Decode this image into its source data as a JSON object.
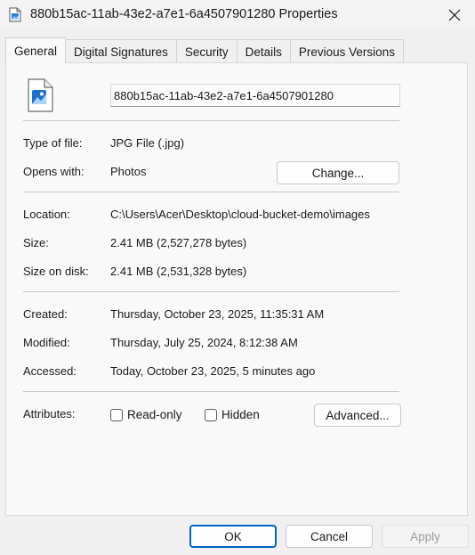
{
  "window": {
    "title": "880b15ac-11ab-43e2-a7e1-6a4507901280 Properties",
    "close_icon": "close-icon",
    "app_icon": "image-file-icon"
  },
  "tabs": [
    {
      "label": "General",
      "active": true
    },
    {
      "label": "Digital Signatures",
      "active": false
    },
    {
      "label": "Security",
      "active": false
    },
    {
      "label": "Details",
      "active": false
    },
    {
      "label": "Previous Versions",
      "active": false
    }
  ],
  "general": {
    "file_icon": "image-file-icon",
    "filename": "880b15ac-11ab-43e2-a7e1-6a4507901280",
    "type_label": "Type of file:",
    "type_value": "JPG File (.jpg)",
    "opens_label": "Opens with:",
    "opens_value": "Photos",
    "change_button": "Change...",
    "location_label": "Location:",
    "location_value": "C:\\Users\\Acer\\Desktop\\cloud-bucket-demo\\images",
    "size_label": "Size:",
    "size_value": "2.41 MB (2,527,278 bytes)",
    "size_disk_label": "Size on disk:",
    "size_disk_value": "2.41 MB (2,531,328 bytes)",
    "created_label": "Created:",
    "created_value": "Thursday, October 23, 2025, 11:35:31 AM",
    "modified_label": "Modified:",
    "modified_value": "Thursday, July 25, 2024, 8:12:38 AM",
    "accessed_label": "Accessed:",
    "accessed_value": "Today, October 23, 2025, 5 minutes ago",
    "attributes_label": "Attributes:",
    "readonly_label": "Read-only",
    "readonly_checked": false,
    "hidden_label": "Hidden",
    "hidden_checked": false,
    "advanced_button": "Advanced..."
  },
  "footer": {
    "ok": "OK",
    "cancel": "Cancel",
    "apply": "Apply"
  },
  "colors": {
    "accent": "#0067c0",
    "background": "#f0f0f0",
    "panel": "#f9f9f9"
  }
}
